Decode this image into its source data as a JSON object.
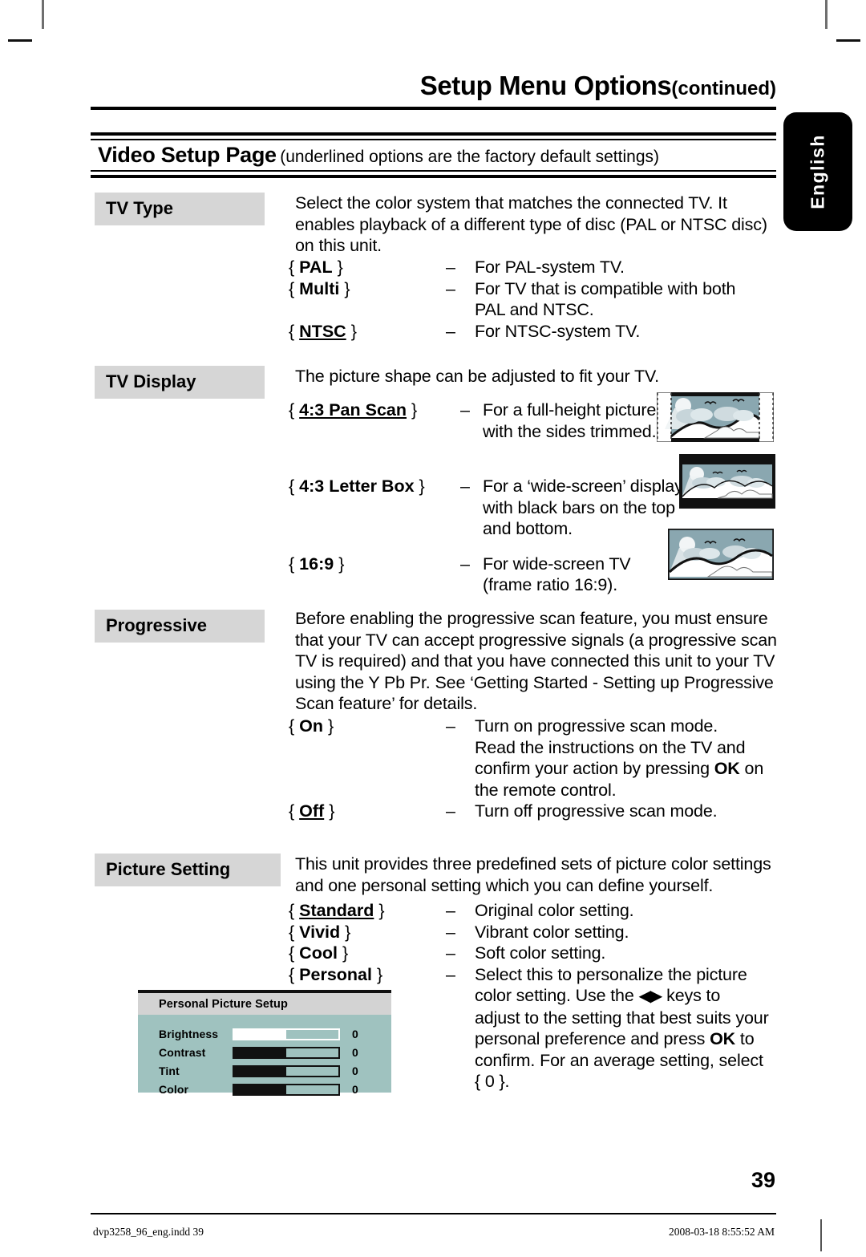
{
  "header": {
    "title": "Setup Menu Options",
    "title_suffix": "(continued)",
    "section_title": "Video Setup Page",
    "section_note": "(underlined options are the factory default settings)"
  },
  "lang_tab": {
    "label": "English"
  },
  "sections": [
    {
      "label": "TV Type",
      "intro": "Select the color system that matches the connected TV. It enables playback of a different type of disc (PAL or NTSC disc) on this unit.",
      "options": [
        {
          "key": "{ PAL }",
          "dash": "–",
          "desc": "For PAL-system TV.",
          "underlined": false
        },
        {
          "key": "{ Multi }",
          "dash": "–",
          "desc": "For TV that is compatible with both PAL and NTSC.",
          "underlined": false
        },
        {
          "key": "{ NTSC }",
          "dash": "–",
          "desc": "For NTSC-system TV.",
          "underlined": true
        }
      ]
    },
    {
      "label": "TV Display",
      "intro": "The picture shape can be adjusted to fit your TV.",
      "options": [
        {
          "key": "{ 4:3 Pan Scan }",
          "dash": "–",
          "desc": "For a full-height picture with the sides trimmed.",
          "underlined": true
        },
        {
          "key": "{ 4:3 Letter Box }",
          "dash": "–",
          "desc": "For a ‘wide-screen’ display with black bars on the top and bottom.",
          "underlined": false
        },
        {
          "key": "{ 16:9 }",
          "dash": "–",
          "desc": "For wide-screen TV (frame ratio 16:9).",
          "underlined": false
        }
      ]
    },
    {
      "label": "Progressive",
      "intro": "Before enabling the progressive scan feature, you must ensure that your TV can accept progressive signals (a progressive scan TV is required) and that you have connected this unit to your TV using the Y Pb Pr. See ‘Getting Started - Setting up Progressive Scan feature’ for details.",
      "options": [
        {
          "key": "{ On }",
          "dash": "–",
          "desc": "Turn on progressive scan mode. Read the instructions on the TV and confirm your action by pressing OK on the remote control.",
          "underlined": false
        },
        {
          "key": "{ Off }",
          "dash": "–",
          "desc": "Turn off progressive scan mode.",
          "underlined": true
        }
      ]
    },
    {
      "label": "Picture Setting",
      "intro": "This unit provides three predefined sets of picture color settings and one personal setting which you can define yourself.",
      "options": [
        {
          "key": "{ Standard }",
          "dash": "–",
          "desc": "Original color setting.",
          "underlined": true
        },
        {
          "key": "{ Vivid }",
          "dash": "–",
          "desc": "Vibrant color setting.",
          "underlined": false
        },
        {
          "key": "{ Cool }",
          "dash": "–",
          "desc": "Soft color setting.",
          "underlined": false
        },
        {
          "key": "{ Personal }",
          "dash": "–",
          "desc": "Select this to personalize the picture color setting. Use the keys to adjust to the setting that best suits your personal preference and press OK to confirm. For an average setting, select { 0 }.",
          "underlined": false
        }
      ]
    }
  ],
  "tv_type": {
    "intro_lines": [
      "Select the color system that matches the connected TV. It",
      "enables playback of a different type of disc (PAL or NTSC disc)",
      "on this unit."
    ],
    "pal": {
      "key_open": "{",
      "key_label": "PAL",
      "key_close": "}",
      "dash": "–",
      "desc": "For PAL-system TV."
    },
    "multi": {
      "key_open": "{",
      "key_label": "Multi",
      "key_close": "}",
      "dash": "–",
      "desc_line1": "For TV that is compatible with both",
      "desc_line2": "PAL and NTSC."
    },
    "ntsc": {
      "key_open": "{",
      "key_label": "NTSC",
      "key_close": "}",
      "dash": "–",
      "desc": "For NTSC-system TV."
    }
  },
  "tv_display": {
    "intro": "The picture shape can be adjusted to fit your TV.",
    "panscan": {
      "key_open": "{",
      "key_label": "4:3 Pan Scan",
      "key_close": "}",
      "dash": "–",
      "desc_line1": "For a full-height picture",
      "desc_line2": "with the sides trimmed."
    },
    "letterbox": {
      "key_open": "{",
      "key_label": "4:3 Letter Box",
      "key_close": "}",
      "dash": "–",
      "desc_line1": "For a ‘wide-screen’ display",
      "desc_line2": "with black bars on the top",
      "desc_line3": "and bottom."
    },
    "wide": {
      "key_open": "{",
      "key_label": "16:9",
      "key_close": "}",
      "dash": "–",
      "desc_line1": "For wide-screen TV",
      "desc_line2": "(frame ratio 16:9)."
    }
  },
  "progressive": {
    "intro_lines": [
      "Before enabling the progressive scan feature, you must ensure",
      "that your TV can accept progressive signals (a progressive scan",
      "TV is required) and that you have connected this unit to your TV",
      "using the Y Pb Pr. See ‘Getting Started - Setting up Progressive",
      "Scan feature’ for details."
    ],
    "on": {
      "key_open": "{",
      "key_label": "On",
      "key_close": "}",
      "dash": "–",
      "desc_line1": "Turn on progressive scan mode.",
      "desc_line2": "Read the instructions on the TV and",
      "desc_line3_a": "confirm your action by pressing ",
      "desc_line3_b": "OK",
      "desc_line3_c": " on",
      "desc_line4": "the remote control."
    },
    "off": {
      "key_open": "{",
      "key_label": "Off",
      "key_close": "}",
      "dash": "–",
      "desc": "Turn off progressive scan mode."
    }
  },
  "picture_setting": {
    "intro_lines": [
      "This unit provides three predefined sets of picture color settings",
      "and one personal setting which you can define yourself."
    ],
    "standard": {
      "key_open": "{",
      "key_label": "Standard",
      "key_close": "}",
      "dash": "–",
      "desc": "Original color setting."
    },
    "vivid": {
      "key_open": "{",
      "key_label": "Vivid",
      "key_close": "}",
      "dash": "–",
      "desc": "Vibrant color setting."
    },
    "cool": {
      "key_open": "{",
      "key_label": "Cool",
      "key_close": "}",
      "dash": "–",
      "desc": "Soft color setting."
    },
    "personal": {
      "key_open": "{",
      "key_label": "Personal",
      "key_close": "}",
      "dash": "–",
      "desc_line1": "Select this to personalize the picture",
      "desc_line2_a": "color setting. Use the ",
      "desc_line2_b": " keys to",
      "desc_line3": "adjust to the setting that best suits your",
      "desc_line4_a": "personal preference and press ",
      "desc_line4_b": "OK",
      "desc_line4_c": " to",
      "desc_line5": "confirm. For an average setting, select",
      "desc_line6": "{ 0 }."
    }
  },
  "osd": {
    "title": "Personal Picture Setup",
    "rows": [
      {
        "name": "Brightness",
        "value": "0",
        "fill_pct": 50,
        "selected": true
      },
      {
        "name": "Contrast",
        "value": "0",
        "fill_pct": 50,
        "selected": false
      },
      {
        "name": "Tint",
        "value": "0",
        "fill_pct": 50,
        "selected": false
      },
      {
        "name": "Color",
        "value": "0",
        "fill_pct": 50,
        "selected": false
      }
    ]
  },
  "footer": {
    "page_number": "39",
    "file_name": "dvp3258_96_eng.indd   39",
    "timestamp": "2008-03-18   8:55:52 AM"
  },
  "colors": {
    "label_gray": "#d6d6d6",
    "osd_teal": "#9fc2bf",
    "osd_title_gray": "#d3d3d3",
    "sky": "#8aa7b0",
    "ink": "#000000"
  }
}
